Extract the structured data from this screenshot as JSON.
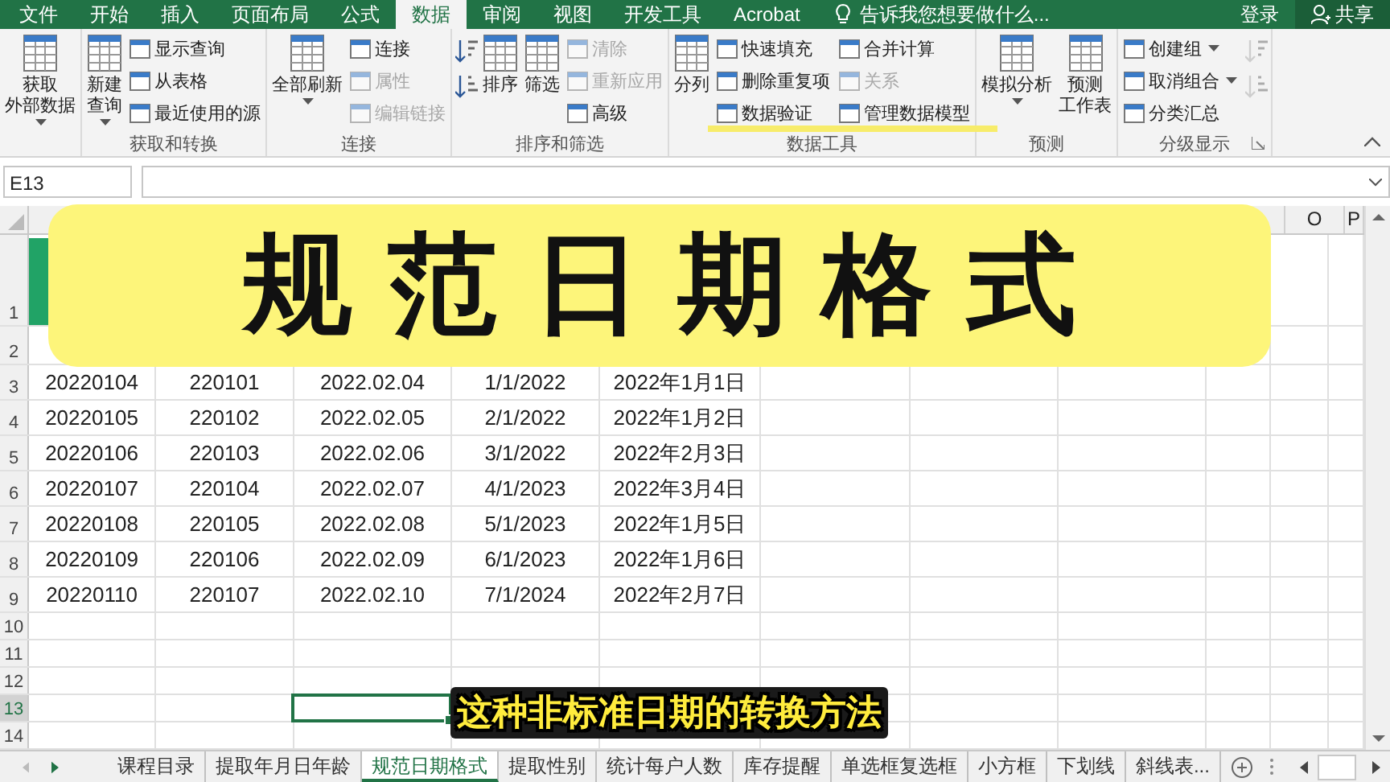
{
  "ribbon_tabs": [
    {
      "label": "文件",
      "selected": false
    },
    {
      "label": "开始",
      "selected": false
    },
    {
      "label": "插入",
      "selected": false
    },
    {
      "label": "页面布局",
      "selected": false
    },
    {
      "label": "公式",
      "selected": false
    },
    {
      "label": "数据",
      "selected": true
    },
    {
      "label": "审阅",
      "selected": false
    },
    {
      "label": "视图",
      "selected": false
    },
    {
      "label": "开发工具",
      "selected": false
    },
    {
      "label": "Acrobat",
      "selected": false
    }
  ],
  "tell_me": {
    "placeholder": "告诉我您想要做什么..."
  },
  "account": {
    "sign_in": "登录",
    "share": "共享"
  },
  "ribbon_groups": [
    {
      "items": [
        {
          "kind": "large",
          "lines": [
            "获取",
            "外部数据"
          ],
          "dropdown": true,
          "disabled": false
        }
      ]
    },
    {
      "label": "获取和转换",
      "items": [
        {
          "kind": "large",
          "lines": [
            "新建",
            "查询"
          ],
          "dropdown": true,
          "disabled": false
        },
        {
          "kind": "small",
          "label": "显示查询",
          "disabled": false
        },
        {
          "kind": "small",
          "label": "从表格",
          "disabled": false
        },
        {
          "kind": "small",
          "label": "最近使用的源",
          "disabled": false
        }
      ]
    },
    {
      "label": "连接",
      "items": [
        {
          "kind": "large",
          "lines": [
            "全部刷新"
          ],
          "dropdown": true,
          "disabled": false
        },
        {
          "kind": "small",
          "label": "连接",
          "disabled": false
        },
        {
          "kind": "small",
          "label": "属性",
          "disabled": true
        },
        {
          "kind": "small",
          "label": "编辑链接",
          "disabled": true
        }
      ]
    },
    {
      "label": "排序和筛选",
      "items": [
        {
          "kind": "icons",
          "disabled": false
        },
        {
          "kind": "large",
          "lines": [
            "排序"
          ],
          "dropdown": false,
          "disabled": false
        },
        {
          "kind": "large",
          "lines": [
            "筛选"
          ],
          "dropdown": false,
          "disabled": false
        },
        {
          "kind": "small",
          "label": "清除",
          "disabled": true
        },
        {
          "kind": "small",
          "label": "重新应用",
          "disabled": true
        },
        {
          "kind": "small",
          "label": "高级",
          "disabled": false
        }
      ]
    },
    {
      "label": "数据工具",
      "items": [
        {
          "kind": "large",
          "lines": [
            "分列"
          ],
          "dropdown": false,
          "disabled": false
        },
        {
          "kind": "small",
          "label": "快速填充",
          "disabled": false
        },
        {
          "kind": "small",
          "label": "删除重复项",
          "disabled": false
        },
        {
          "kind": "small",
          "label": "数据验证",
          "disabled": false
        },
        {
          "kind": "small",
          "label": "合并计算",
          "disabled": false
        },
        {
          "kind": "small",
          "label": "关系",
          "disabled": true
        },
        {
          "kind": "small",
          "label": "管理数据模型",
          "disabled": false
        }
      ]
    },
    {
      "label": "预测",
      "items": [
        {
          "kind": "large",
          "lines": [
            "模拟分析"
          ],
          "dropdown": true,
          "disabled": false
        },
        {
          "kind": "large",
          "lines": [
            "预测",
            "工作表"
          ],
          "dropdown": false,
          "disabled": false
        }
      ]
    },
    {
      "label": "分级显示",
      "launcher": true,
      "items": [
        {
          "kind": "small",
          "label": "创建组",
          "dropdown": true,
          "disabled": false
        },
        {
          "kind": "small",
          "label": "取消组合",
          "dropdown": true,
          "disabled": false
        },
        {
          "kind": "small",
          "label": "分类汇总",
          "disabled": false
        },
        {
          "kind": "icons",
          "disabled": true
        }
      ]
    }
  ],
  "name_box": {
    "value": "E13"
  },
  "column_headers": [
    "O",
    "P"
  ],
  "rows": [
    {
      "number": "1",
      "selected": false
    },
    {
      "number": "2",
      "selected": false
    },
    {
      "number": "3",
      "selected": false,
      "cells": [
        "20220104",
        "220101",
        "2022.02.04",
        "1/1/2022",
        "2022年1月1日"
      ]
    },
    {
      "number": "4",
      "selected": false,
      "cells": [
        "20220105",
        "220102",
        "2022.02.05",
        "2/1/2022",
        "2022年1月2日"
      ]
    },
    {
      "number": "5",
      "selected": false,
      "cells": [
        "20220106",
        "220103",
        "2022.02.06",
        "3/1/2022",
        "2022年2月3日"
      ]
    },
    {
      "number": "6",
      "selected": false,
      "cells": [
        "20220107",
        "220104",
        "2022.02.07",
        "4/1/2023",
        "2022年3月4日"
      ]
    },
    {
      "number": "7",
      "selected": false,
      "cells": [
        "20220108",
        "220105",
        "2022.02.08",
        "5/1/2023",
        "2022年1月5日"
      ]
    },
    {
      "number": "8",
      "selected": false,
      "cells": [
        "20220109",
        "220106",
        "2022.02.09",
        "6/1/2023",
        "2022年1月6日"
      ]
    },
    {
      "number": "9",
      "selected": false,
      "cells": [
        "20220110",
        "220107",
        "2022.02.10",
        "7/1/2024",
        "2022年2月7日"
      ]
    },
    {
      "number": "10",
      "selected": false
    },
    {
      "number": "11",
      "selected": false
    },
    {
      "number": "12",
      "selected": false
    },
    {
      "number": "13",
      "selected": true
    },
    {
      "number": "14",
      "selected": false
    }
  ],
  "sheet_tabs": [
    {
      "label": "课程目录",
      "selected": false
    },
    {
      "label": "提取年月日年龄",
      "selected": false
    },
    {
      "label": "规范日期格式",
      "selected": true
    },
    {
      "label": "提取性别",
      "selected": false
    },
    {
      "label": "统计每户人数",
      "selected": false
    },
    {
      "label": "库存提醒",
      "selected": false
    },
    {
      "label": "单选框复选框",
      "selected": false
    },
    {
      "label": "小方框",
      "selected": false
    },
    {
      "label": "下划线",
      "selected": false
    },
    {
      "label": "斜线表...",
      "selected": false
    }
  ],
  "overlay": {
    "title": "规范日期格式",
    "caption": "这种非标准日期的转换方法"
  }
}
